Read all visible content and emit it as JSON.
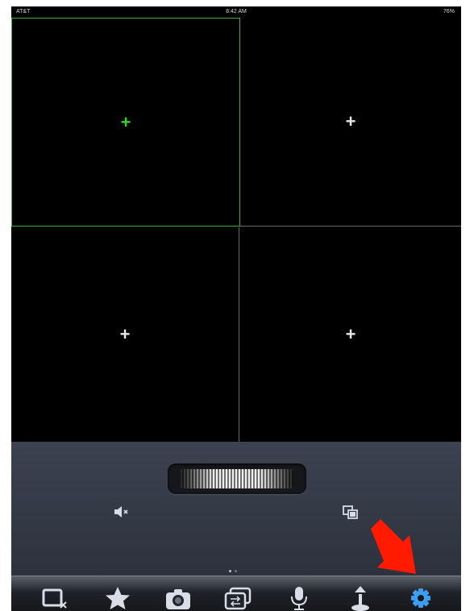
{
  "status_bar": {
    "carrier": "AT&T",
    "time": "8:42 AM",
    "battery": "76%"
  },
  "camera_grid": {
    "cells": [
      {
        "add_symbol": "+",
        "selected": true,
        "color": "#2fd42f"
      },
      {
        "add_symbol": "+",
        "selected": false,
        "color": "#e6e6e6"
      },
      {
        "add_symbol": "+",
        "selected": false,
        "color": "#e6e6e6"
      },
      {
        "add_symbol": "+",
        "selected": false,
        "color": "#e6e6e6"
      }
    ]
  },
  "control_panel": {
    "jog_wheel": "ptz-jog-wheel",
    "left_icon": "speaker-muted-icon",
    "right_icon": "multi-screen-icon",
    "page_indicator": {
      "pages": 2,
      "current": 1
    }
  },
  "toolbar": {
    "items": [
      "close-stream-icon",
      "favorite-star-icon",
      "snapshot-camera-icon",
      "switch-view-icon",
      "microphone-icon",
      "joystick-icon",
      "settings-gear-icon"
    ]
  },
  "annotation": {
    "arrow_color": "#ff1a00",
    "points_to": "settings-gear-icon"
  },
  "colors": {
    "accent_green": "#2fd42f",
    "tool_icon": "#d9dde5",
    "gear_blue": "#3d9df0"
  }
}
